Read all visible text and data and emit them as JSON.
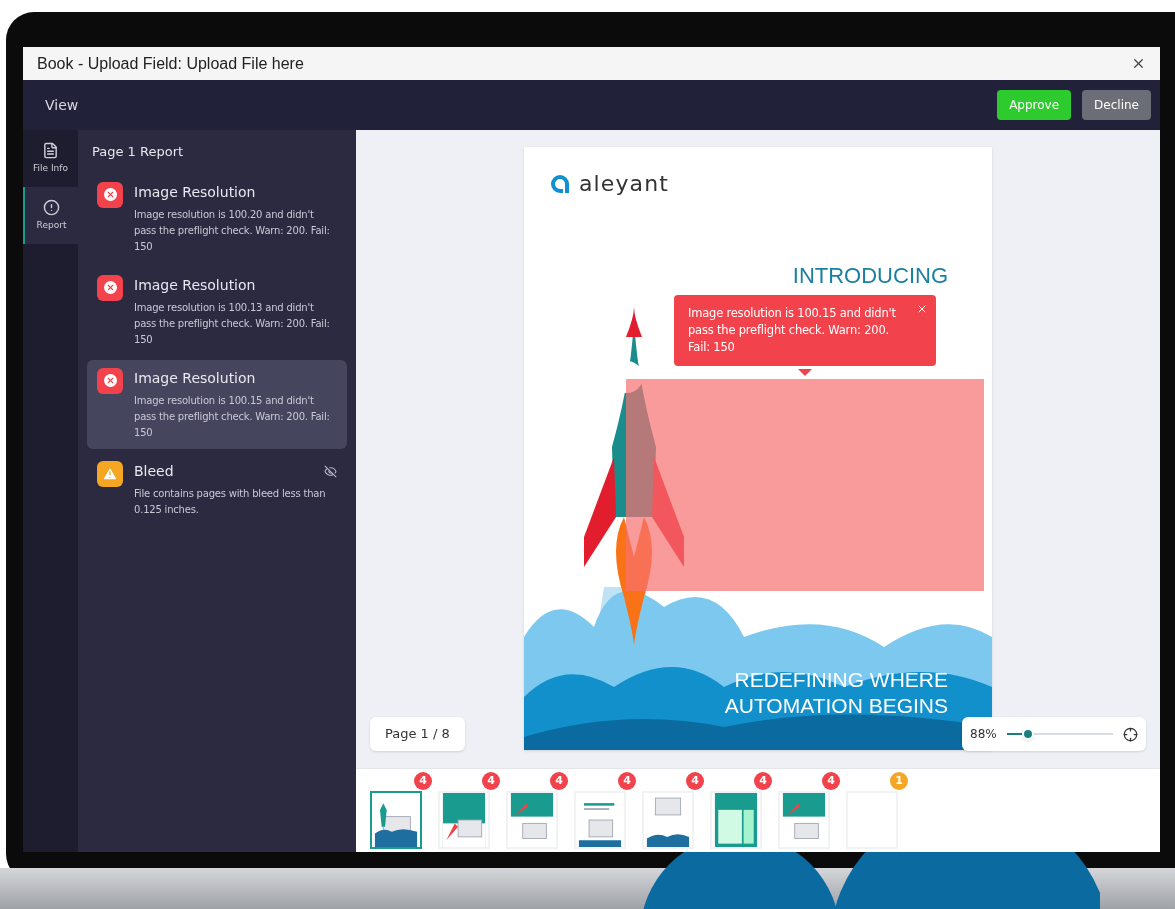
{
  "window": {
    "title": "Book - Upload Field: Upload File here"
  },
  "toolbar": {
    "menu": "View",
    "buttons": [
      {
        "label": "Approve",
        "kind": "primary"
      },
      {
        "label": "Decline",
        "kind": "secondary"
      }
    ]
  },
  "nav": [
    {
      "label": "File Info",
      "kind": "file",
      "selected": false
    },
    {
      "label": "Report",
      "kind": "report",
      "selected": true
    }
  ],
  "report": {
    "title": "Page 1 Report",
    "items": [
      {
        "title": "Image Resolution",
        "message": "Image resolution is 100.20 and didn't pass the preflight check. Warn: 200. Fail: 150",
        "kind": "error",
        "selected": false,
        "hidden": false
      },
      {
        "title": "Image Resolution",
        "message": "Image resolution is 100.13 and didn't pass the preflight check. Warn: 200. Fail: 150",
        "kind": "error",
        "selected": false,
        "hidden": false
      },
      {
        "title": "Image Resolution",
        "message": "Image resolution is 100.15 and didn't pass the preflight check. Warn: 200. Fail: 150",
        "kind": "error",
        "selected": true,
        "hidden": false
      },
      {
        "title": "Bleed",
        "message": "File contains pages with bleed less than 0.125 inches.",
        "kind": "warning",
        "selected": false,
        "hidden": true
      }
    ]
  },
  "page": {
    "logo": "aleyant",
    "heading": "INTRODUCING",
    "tagline": [
      "REDEFINING WHERE",
      "AUTOMATION BEGINS"
    ]
  },
  "tooltip": {
    "text": "Image resolution is 100.15 and didn't pass the preflight check. Warn: 200. Fail: 150"
  },
  "page_indicator": "Page 1 / 8",
  "zoom": {
    "reading": "88%",
    "level": 0.2
  },
  "thumbnails": [
    {
      "count": "4",
      "color": "#f2424c",
      "kind": "cover",
      "selected": true
    },
    {
      "count": "4",
      "color": "#f2424c",
      "kind": "teal",
      "selected": false
    },
    {
      "count": "4",
      "color": "#f2424c",
      "kind": "teal-top",
      "selected": false
    },
    {
      "count": "4",
      "color": "#f2424c",
      "kind": "white",
      "selected": false
    },
    {
      "count": "4",
      "color": "#f2424c",
      "kind": "white-cloud",
      "selected": false
    },
    {
      "count": "4",
      "color": "#f2424c",
      "kind": "teal-grid",
      "selected": false
    },
    {
      "count": "4",
      "color": "#f2424c",
      "kind": "teal-top",
      "selected": false
    },
    {
      "count": "1",
      "color": "#f5a623",
      "kind": "blank",
      "selected": false
    }
  ]
}
